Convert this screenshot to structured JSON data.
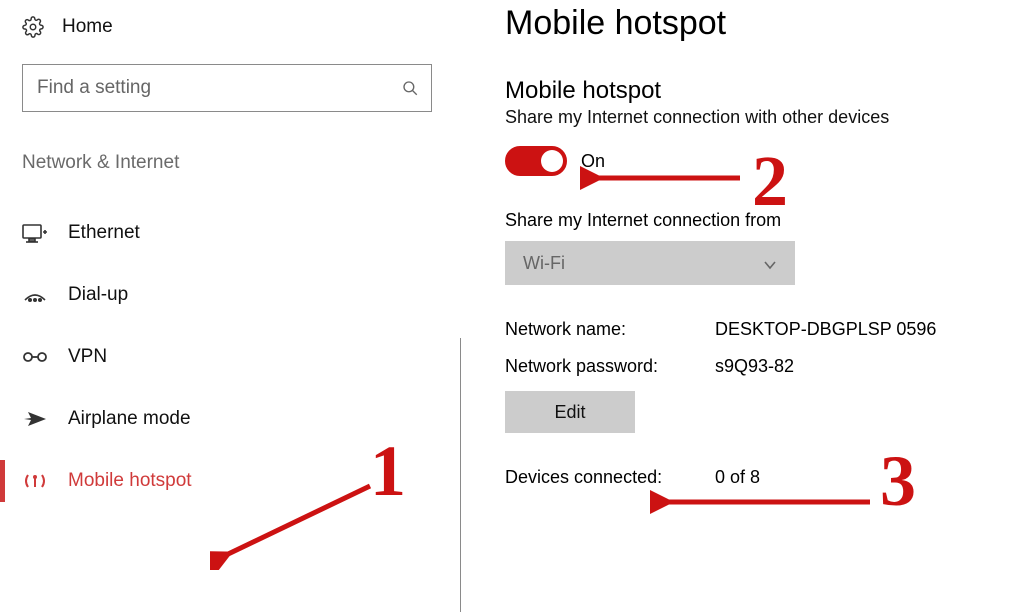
{
  "sidebar": {
    "home_label": "Home",
    "search_placeholder": "Find a setting",
    "section_title": "Network & Internet",
    "items": [
      {
        "label": "Ethernet"
      },
      {
        "label": "Dial-up"
      },
      {
        "label": "VPN"
      },
      {
        "label": "Airplane mode"
      },
      {
        "label": "Mobile hotspot"
      }
    ]
  },
  "main": {
    "page_title": "Mobile hotspot",
    "sub_title": "Mobile hotspot",
    "share_desc": "Share my Internet connection with other devices",
    "toggle_state_label": "On",
    "share_from_label": "Share my Internet connection from",
    "share_from_value": "Wi-Fi",
    "network_name_label": "Network name:",
    "network_name_value": "DESKTOP-DBGPLSP 0596",
    "network_password_label": "Network password:",
    "network_password_value": "s9Q93-82",
    "edit_label": "Edit",
    "devices_connected_label": "Devices connected:",
    "devices_connected_value": "0 of 8"
  },
  "annotations": {
    "num1": "1",
    "num2": "2",
    "num3": "3"
  },
  "colors": {
    "accent_red": "#cc1212",
    "disabled_gray": "#ccc"
  }
}
